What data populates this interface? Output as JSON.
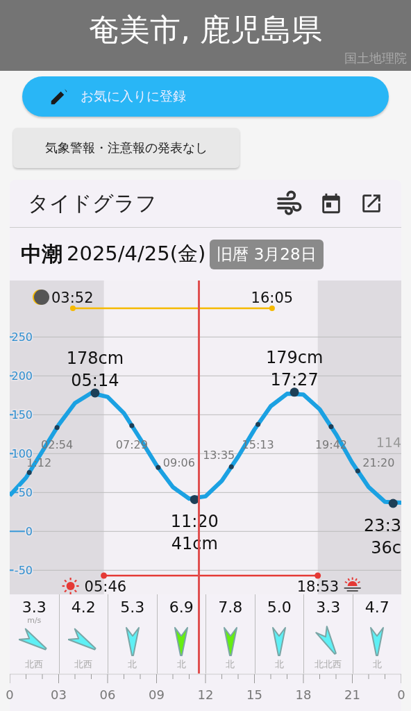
{
  "header": {
    "title": "奄美市, 鹿児島県",
    "attribution": "国土地理院"
  },
  "favorite_button": {
    "label": "お気に入りに登録"
  },
  "warning_chip": {
    "label": "気象警報・注意報の発表なし"
  },
  "card": {
    "title": "タイドグラフ",
    "date_row": {
      "tide_name": "中潮",
      "date": "2025/4/25(金)",
      "lunar_badge": "旧暦 3月28日"
    },
    "tide_chart": {
      "chart_data": {
        "type": "line",
        "categories": [
          null,
          null,
          null,
          null,
          null,
          null,
          null,
          null,
          null,
          null,
          null,
          null,
          null,
          null,
          null,
          null,
          null,
          null,
          null,
          null,
          null,
          null,
          null,
          null,
          null
        ],
        "series": [
          {
            "color": "#1ba1e2",
            "values": [
              46,
              69,
              103,
              137,
              165,
              178,
              173,
              152,
              119,
              85,
              57,
              42,
              45,
              65,
              96,
              131,
              161,
              177,
              176,
              157,
              125,
              88,
              57,
              38,
              37
            ]
          }
        ],
        "ylim": [
          -231,
          453
        ],
        "yticks": [
          250,
          200,
          150,
          100,
          50,
          0,
          -50
        ],
        "grid": true
      },
      "time_axis": [
        "0",
        "03",
        "06",
        "09",
        "12",
        "15",
        "18",
        "21",
        "0"
      ],
      "time_marks": [
        "1:12",
        "02:54",
        "07:29",
        "09:06",
        "13:35",
        "15:13",
        "19:42",
        "21:20"
      ],
      "extremes": [
        {
          "kind": "high",
          "height": "178cm",
          "time": "05:14"
        },
        {
          "kind": "low",
          "height": "41cm",
          "time": "11:20"
        },
        {
          "kind": "high",
          "height": "179cm",
          "time": "17:27"
        },
        {
          "kind": "low",
          "height": "36c",
          "time": "23:3"
        }
      ],
      "edge_label": "114",
      "moon": {
        "rise": "03:52",
        "set": "16:05"
      },
      "sun": {
        "rise": "05:46",
        "set": "18:53"
      }
    },
    "wind": [
      {
        "speed": "3.3",
        "unit": "m/s",
        "direction": "北西",
        "kind": "nw",
        "color": "#5ef0f5"
      },
      {
        "speed": "4.2",
        "direction": "北西",
        "kind": "nw",
        "color": "#5ef0f5"
      },
      {
        "speed": "5.3",
        "direction": "北",
        "kind": "n",
        "color": "#5ef0f5"
      },
      {
        "speed": "6.9",
        "direction": "北",
        "kind": "n",
        "color": "#66ee11"
      },
      {
        "speed": "7.8",
        "direction": "北",
        "kind": "n",
        "color": "#66ee11"
      },
      {
        "speed": "5.0",
        "direction": "北",
        "kind": "n",
        "color": "#5ef0f5"
      },
      {
        "speed": "3.3",
        "direction": "北北西",
        "kind": "nnw",
        "color": "#5ef0f5"
      },
      {
        "speed": "4.7",
        "direction": "北",
        "kind": "n",
        "color": "#5ef0f5"
      }
    ]
  }
}
